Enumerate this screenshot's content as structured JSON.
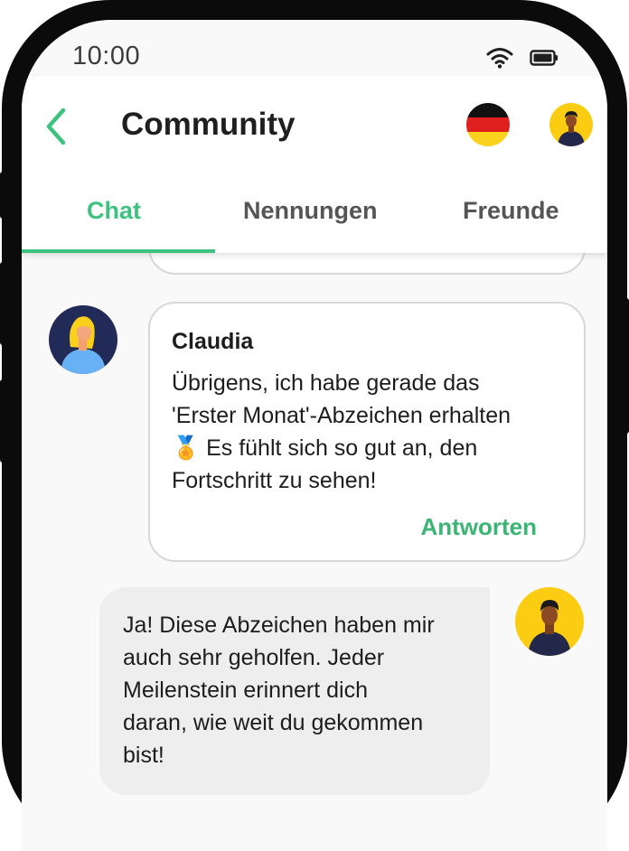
{
  "status_bar": {
    "time": "10:00",
    "icons": [
      "wifi-icon",
      "battery-icon"
    ]
  },
  "app_bar": {
    "title": "Community",
    "back_icon": "chevron-left-icon",
    "language_flag": "german-flag-icon",
    "accent_color": "#3dc37f"
  },
  "tabs": [
    {
      "label": "Chat",
      "active": true
    },
    {
      "label": "Nennungen",
      "active": false
    },
    {
      "label": "Freunde",
      "active": false
    }
  ],
  "messages": [
    {
      "sender": "Claudia",
      "lines": [
        "Übrigens, ich habe gerade das",
        "'Erster Monat'-Abzeichen erhalten",
        "🏅 Es fühlt sich so gut an, den",
        "Fortschritt zu sehen!"
      ],
      "reply_label": "Antworten"
    },
    {
      "sender": "",
      "lines": [
        "Ja! Diese Abzeichen haben mir",
        "auch sehr geholfen. Jeder",
        "Meilenstein erinnert dich",
        "daran, wie weit du gekommen",
        "bist!"
      ]
    }
  ]
}
